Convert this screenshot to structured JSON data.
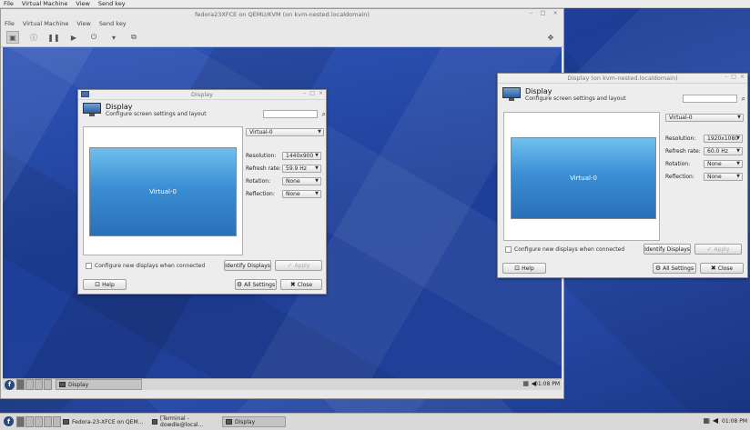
{
  "host_menu": [
    "File",
    "Virtual Machine",
    "View",
    "Send key"
  ],
  "vm_window": {
    "title": "fedora23XFCE on QEMU/KVM (on kvm-nested.localdomain)",
    "menu": [
      "File",
      "Virtual Machine",
      "View",
      "Send key"
    ],
    "window_buttons": [
      "–",
      "□",
      "×"
    ]
  },
  "guest_dialog": {
    "window_title": "Display",
    "title": "Display",
    "subtitle": "Configure screen settings and layout",
    "output_select": "Virtual-0",
    "preview_label": "Virtual-0",
    "resolution_label": "Resolution:",
    "resolution": "1440x900",
    "refresh_label": "Refresh rate:",
    "refresh": "59.9 Hz",
    "rotation_label": "Rotation:",
    "rotation": "None",
    "reflection_label": "Reflection:",
    "reflection": "None",
    "checkbox": "Configure new displays when connected",
    "identify": "Identify Displays",
    "apply": "Apply",
    "help": "Help",
    "all_settings": "All Settings",
    "close": "Close"
  },
  "guest_panel": {
    "task": "Display",
    "clock": "01:08 PM"
  },
  "host_dialog": {
    "window_title": "Display (on kvm-nested.localdomain)",
    "title": "Display",
    "subtitle": "Configure screen settings and layout",
    "output_select": "Virtual-0",
    "preview_label": "Virtual-0",
    "resolution_label": "Resolution:",
    "resolution": "1920x1080",
    "refresh_label": "Refresh rate:",
    "refresh": "60.0 Hz",
    "rotation_label": "Rotation:",
    "rotation": "None",
    "reflection_label": "Reflection:",
    "reflection": "None",
    "checkbox": "Configure new displays when connected",
    "identify": "Identify Displays",
    "apply": "Apply",
    "help": "Help",
    "all_settings": "All Settings",
    "close": "Close"
  },
  "host_taskbar": {
    "tasks": [
      "Fedora-23-XFCE on QEM...",
      "[Terminal - dowdle@local...",
      "Display"
    ],
    "clock": "01:08 PM"
  },
  "colors": {
    "wallpaper": "#1f3a8f",
    "preview_top": "#6fc0ee",
    "preview_bottom": "#2b6fb9"
  }
}
